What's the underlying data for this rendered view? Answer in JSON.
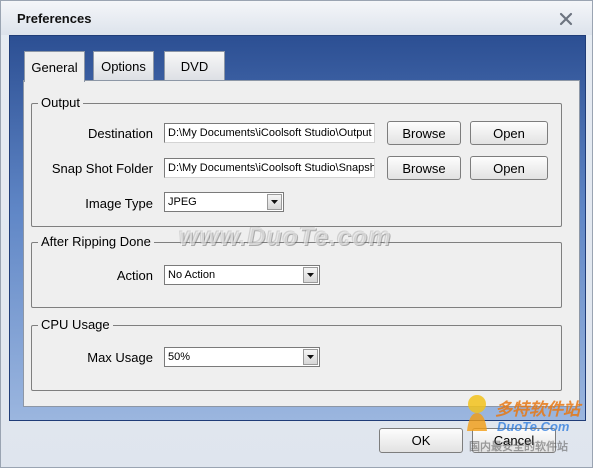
{
  "window": {
    "title": "Preferences"
  },
  "tabs": [
    {
      "label": "General",
      "active": true
    },
    {
      "label": "Options",
      "active": false
    },
    {
      "label": "DVD",
      "active": false
    }
  ],
  "output": {
    "legend": "Output",
    "destination_label": "Destination",
    "destination_value": "D:\\My Documents\\iCoolsoft Studio\\Output",
    "snapshot_label": "Snap Shot Folder",
    "snapshot_value": "D:\\My Documents\\iCoolsoft Studio\\Snapshot",
    "image_type_label": "Image Type",
    "image_type_value": "JPEG",
    "browse_label": "Browse",
    "open_label": "Open"
  },
  "after_ripping": {
    "legend": "After Ripping Done",
    "action_label": "Action",
    "action_value": "No Action"
  },
  "cpu": {
    "legend": "CPU Usage",
    "max_label": "Max Usage",
    "max_value": "50%"
  },
  "footer": {
    "ok_label": "OK",
    "cancel_label": "Cancel"
  },
  "watermark": {
    "main": "www.DuoTe.com",
    "logo_top": "多特软件站",
    "logo_site": "DuoTe.Com",
    "logo_bottom": "国内最安全的软件站"
  },
  "colors": {
    "frame_top": "#2c4f93",
    "frame_bottom": "#9bb6df",
    "panel_bg": "#efefef"
  }
}
